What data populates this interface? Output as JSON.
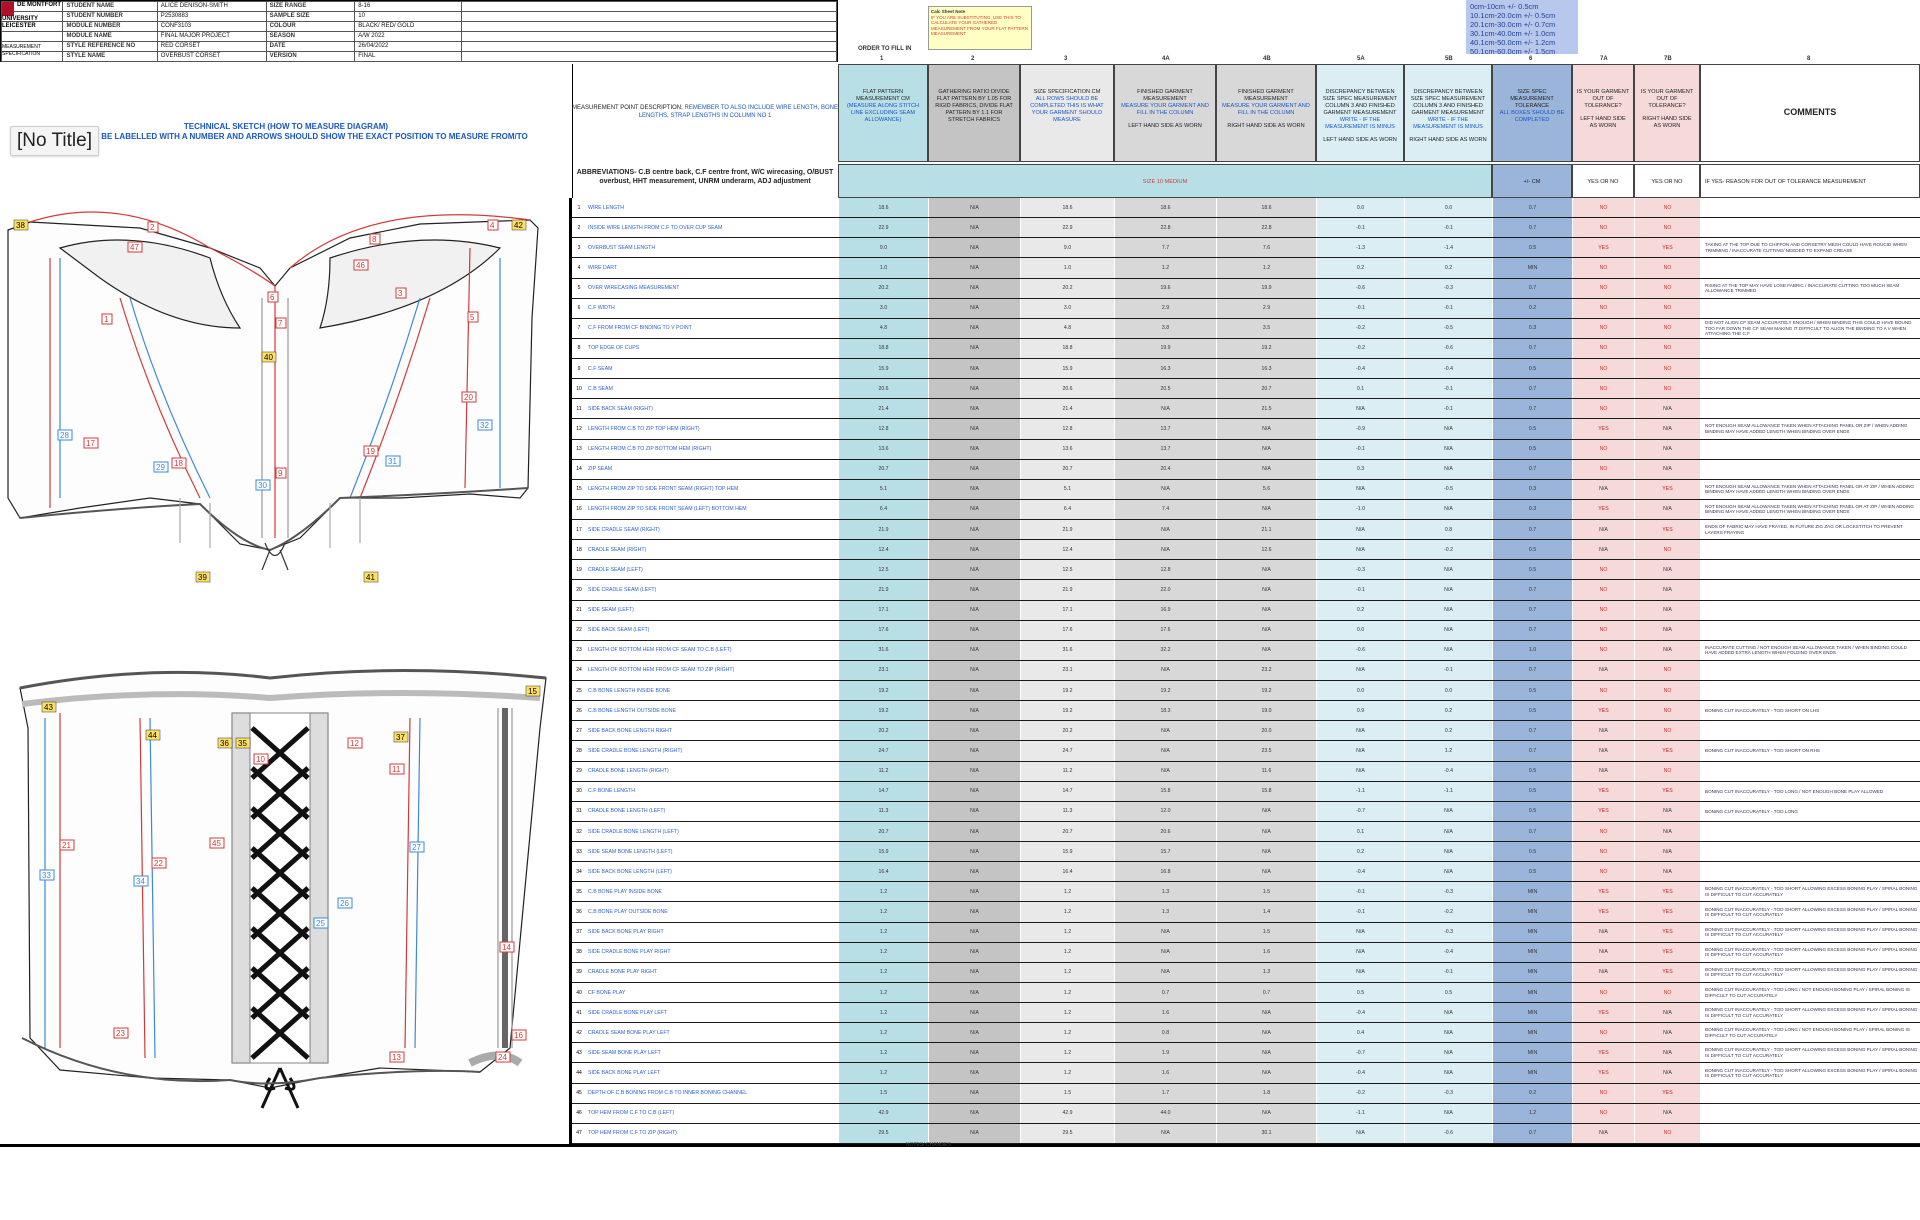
{
  "header": {
    "logo_text": "DE MONTFORT UNIVERSITY LEICESTER",
    "measurement_label": "MEASUREMENT SPECIFICATION",
    "fields": [
      {
        "label": "STUDENT NAME",
        "value": "ALICE DENISON-SMITH",
        "label2": "SIZE RANGE",
        "value2": "8-16"
      },
      {
        "label": "STUDENT NUMBER",
        "value": "P2530883",
        "label2": "SAMPLE SIZE",
        "value2": "10"
      },
      {
        "label": "MODULE NUMBER",
        "value": "CONF3103",
        "label2": "COLOUR",
        "value2": "BLACK/ RED/ GOLD"
      },
      {
        "label": "MODULE NAME",
        "value": "FINAL MAJOR PROJECT",
        "label2": "SEASON",
        "value2": "A/W 2022"
      },
      {
        "label": "STYLE REFERENCE NO",
        "value": "RED CORSET",
        "label2": "DATE",
        "value2": "26/04/2022"
      },
      {
        "label": "STYLE NAME",
        "value": "OVERBUST CORSET",
        "label2": "VERSION",
        "value2": "FINAL"
      }
    ]
  },
  "sticky_note": {
    "title": "Calc Sheet Note",
    "text": "IF YOU ARE SUBSTITUTING, USE THIS TO CALCULATE YOUR GATHERED MEASUREMENT FROM YOUR FLAT PATTERN MEASUREMENT"
  },
  "tolerance_box": [
    "0cm-10cm +/- 0.5cm",
    "10.1cm-20.0cm +/- 0.5cm",
    "20.1cm-30.0cm +/- 0.7cm",
    "30.1cm-40.0cm +/- 1.0cm",
    "40.1cm-50.0cm +/- 1.2cm",
    "50.1cm-60.0cm +/- 1.5cm"
  ],
  "order_to_fill_in": "ORDER TO FILL IN",
  "order_numbers": [
    "1",
    "2",
    "3",
    "4A",
    "4B",
    "5A",
    "5B",
    "6",
    "7A",
    "7B",
    "8"
  ],
  "technical_sketch": {
    "title": "TECHNICAL SKETCH (HOW TO MEASURE DIAGRAM)",
    "subtitle": "POINTS MUST BE LABELLED WITH A NUMBER AND ARROWS SHOULD SHOW THE EXACT POSITION TO MEASURE FROM/TO"
  },
  "popup_title": "[No Title]",
  "measurement_desc": {
    "title": "MEASUREMENT POINT DESCRIPTION,",
    "note": "REMEMBER TO ALSO INCLUDE WIRE LENGTH, BONE LENGTHS, STRAP LENGTHS IN COLUMN NO 1"
  },
  "abbreviations": "ABBREVIATIONS- C.B centre back, C.F centre front, W/C wirecasing, O/BUST overbust, HHT measurement, UNRM underarm, ADJ adjustment",
  "columns": [
    {
      "key": "flat",
      "title": "FLAT PATTERN MEASUREMENT CM",
      "note": "(MEASURE ALONG STITCH LINE EXCLUDING SEAM ALLOWANCE)"
    },
    {
      "key": "ratio",
      "title": "GATHERING RATIO DIVIDE FLAT PATTERN BY 1.05 FOR RIGID FABRICS, DIVIDE FLAT PATTERN BY 1.1 FOR STRETCH FABRICS",
      "note": ""
    },
    {
      "key": "spec",
      "title": "SIZE SPECIFICATION CM",
      "note": "ALL ROWS SHOULD BE COMPLETED THIS IS WHAT YOUR GARMENT SHOULD MEASURE"
    },
    {
      "key": "left",
      "title": "FINISHED GARMENT MEASUREMENT",
      "note": "MEASURE YOUR GARMENT AND FILL IN THE COLUMN",
      "foot": "LEFT HAND SIDE AS WORN"
    },
    {
      "key": "right",
      "title": "FINISHED GARMENT MEASUREMENT",
      "note": "MEASURE YOUR GARMENT AND FILL IN THE COLUMN",
      "foot": "RIGHT HAND SIDE AS WORN"
    },
    {
      "key": "disc_l",
      "title": "DISCREPANCY BETWEEN SIZE SPEC MEASUREMENT COLUMN 3 AND FINISHED GARMENT MEASUREMENT",
      "note": "WRITE - IF THE MEASUREMENT IS MINUS",
      "foot": "LEFT HAND SIDE AS WORN"
    },
    {
      "key": "disc_r",
      "title": "DISCREPANCY BETWEEN SIZE SPEC MEASUREMENT COLUMN 3 AND FINISHED GARMENT MEASUREMENT",
      "note": "WRITE - IF THE MEASUREMENT IS MINUS",
      "foot": "RIGHT HAND SIDE AS WORN"
    },
    {
      "key": "tol",
      "title": "SIZE SPEC MEASUREMENT TOLERANCE",
      "note": "ALL BOXES SHOULD BE COMPLETED"
    },
    {
      "key": "ool",
      "title": "IS YOUR GARMENT OUT OF TOLERANCE?",
      "note": "",
      "foot": "LEFT HAND SIDE AS WORN"
    },
    {
      "key": "oor",
      "title": "IS YOUR GARMENT OUT OF TOLERANCE?",
      "note": "",
      "foot": "RIGHT HAND SIDE AS WORN"
    },
    {
      "key": "com",
      "title": "COMMENTS",
      "note": ""
    }
  ],
  "subheaders": {
    "size_label": "SIZE",
    "size_value": "10",
    "size_suffix": "MEDIUM",
    "tol": "+/- CM",
    "yes_no_l": "YES OR NO",
    "yes_no_r": "YES OR NO",
    "comments": "IF YES- REASON FOR OUT OF TOLERANCE MEASUREMENT"
  },
  "rows": [
    {
      "n": "1",
      "d": "WIRE LENGTH",
      "f": "18.6",
      "r": "N/A",
      "s": "18.6",
      "l": "18.6",
      "rr": "18.6",
      "dl": "0.0",
      "dr": "0.0",
      "t": "0.7",
      "ol": "NO",
      "or": "NO",
      "c": ""
    },
    {
      "n": "2",
      "d": "INSIDE WIRE LENGTH FROM C.F TO OVER CUP SEAM",
      "f": "22.9",
      "r": "N/A",
      "s": "22.9",
      "l": "22.8",
      "rr": "22.8",
      "dl": "-0.1",
      "dr": "-0.1",
      "t": "0.7",
      "ol": "NO",
      "or": "NO",
      "c": ""
    },
    {
      "n": "3",
      "d": "OVERBUST SEAM LENGTH",
      "f": "9.0",
      "r": "N/A",
      "s": "9.0",
      "l": "7.7",
      "rr": "7.6",
      "dl": "-1.3",
      "dr": "-1.4",
      "t": "0.5",
      "ol": "YES",
      "or": "YES",
      "c": "TAKING AT THE TOP DUE TO CHIFFON AND CORSETRY MESH COULD HAVE ROUCID WHEN TRIMMING / INACCURATE CUTTING/ NEEDED TO EXPAND CREASE"
    },
    {
      "n": "4",
      "d": "WIRE DART",
      "f": "1.0",
      "r": "N/A",
      "s": "1.0",
      "l": "1.2",
      "rr": "1.2",
      "dl": "0.2",
      "dr": "0.2",
      "t": "MIN",
      "ol": "NO",
      "or": "NO",
      "c": ""
    },
    {
      "n": "5",
      "d": "OVER WIRECASING MEASUREMENT",
      "f": "20.2",
      "r": "N/A",
      "s": "20.2",
      "l": "19.6",
      "rr": "19.9",
      "dl": "-0.6",
      "dr": "-0.3",
      "t": "0.7",
      "ol": "NO",
      "or": "NO",
      "c": "RISING AT THE TOP MAY HAVE LOSE FABRIC / INACCURATE CUTTING TOO MUCH SEAM ALLOWANCE TRIMMED"
    },
    {
      "n": "6",
      "d": "C.F WIDTH",
      "f": "3.0",
      "r": "N/A",
      "s": "3.0",
      "l": "2.9",
      "rr": "2.9",
      "dl": "-0.1",
      "dr": "-0.1",
      "t": "0.2",
      "ol": "NO",
      "or": "NO",
      "c": ""
    },
    {
      "n": "7",
      "d": "C.F FROM FROM CF BINDING TO V POINT",
      "f": "4.8",
      "r": "N/A",
      "s": "4.8",
      "l": "3.8",
      "rr": "3.5",
      "dl": "-0.2",
      "dr": "-0.5",
      "t": "0.3",
      "ol": "NO",
      "or": "NO",
      "c": "DID NOT ALIGN CF SEAM ACCURATELY ENOUGH / WHEN BINDING THIS COULD HAVE BOUND TOO FAR DOWN THE CF SEAM MAKING IT DIFFICULT TO ALIGN THE BINDING TO A V WHEN ATTACHING THE C.F"
    },
    {
      "n": "8",
      "d": "TOP EDGE OF CUPS",
      "f": "18.8",
      "r": "N/A",
      "s": "18.8",
      "l": "19.9",
      "rr": "19.2",
      "dl": "-0.2",
      "dr": "-0.6",
      "t": "0.7",
      "ol": "NO",
      "or": "NO",
      "c": ""
    },
    {
      "n": "9",
      "d": "C.F SEAM",
      "f": "15.9",
      "r": "N/A",
      "s": "15.9",
      "l": "16.3",
      "rr": "16.3",
      "dl": "-0.4",
      "dr": "-0.4",
      "t": "0.5",
      "ol": "NO",
      "or": "NO",
      "c": ""
    },
    {
      "n": "10",
      "d": "C.B SEAM",
      "f": "20.6",
      "r": "N/A",
      "s": "20.6",
      "l": "20.5",
      "rr": "20.7",
      "dl": "0.1",
      "dr": "-0.1",
      "t": "0.7",
      "ol": "NO",
      "or": "NO",
      "c": ""
    },
    {
      "n": "11",
      "d": "SIDE BACK SEAM (RIGHT)",
      "f": "21.4",
      "r": "N/A",
      "s": "21.4",
      "l": "N/A",
      "rr": "21.5",
      "dl": "N/A",
      "dr": "-0.1",
      "t": "0.7",
      "ol": "NO",
      "or": "N/A",
      "c": ""
    },
    {
      "n": "12",
      "d": "LENGTH FROM C.B TO ZIP TOP HEM (RIGHT)",
      "f": "12.8",
      "r": "N/A",
      "s": "12.8",
      "l": "13.7",
      "rr": "N/A",
      "dl": "-0.9",
      "dr": "N/A",
      "t": "0.5",
      "ol": "YES",
      "or": "N/A",
      "c": "NOT ENOUGH SEAM ALLOWANCE TAKEN WHEN ATTACHING PANEL OR ZIP / WHEN ADDING BINDING MAY HAVE ADDED LENGTH WHEN BINDING OVER ENDS"
    },
    {
      "n": "13",
      "d": "LENGTH FROM C.B TO ZIP BOTTOM HEM (RIGHT)",
      "f": "13.6",
      "r": "N/A",
      "s": "13.6",
      "l": "13.7",
      "rr": "N/A",
      "dl": "-0.1",
      "dr": "N/A",
      "t": "0.5",
      "ol": "NO",
      "or": "N/A",
      "c": ""
    },
    {
      "n": "14",
      "d": "ZIP SEAM",
      "f": "20.7",
      "r": "N/A",
      "s": "20.7",
      "l": "20.4",
      "rr": "N/A",
      "dl": "0.3",
      "dr": "N/A",
      "t": "0.7",
      "ol": "NO",
      "or": "N/A",
      "c": ""
    },
    {
      "n": "15",
      "d": "LENGTH FROM ZIP TO SIDE FRONT SEAM (RIGHT) TOP HEM",
      "f": "5.1",
      "r": "N/A",
      "s": "5.1",
      "l": "N/A",
      "rr": "5.6",
      "dl": "N/A",
      "dr": "-0.5",
      "t": "0.3",
      "ol": "N/A",
      "or": "YES",
      "c": "NOT ENOUGH SEAM ALLOWANCE TAKEN WHEN ATTACHING PANEL OR AT ZIP / WHEN ADDING BINDING MAY HAVE ADDED LENGTH WHEN BINDING OVER ENDS"
    },
    {
      "n": "16",
      "d": "LENGTH FROM ZIP TO SIDE FRONT SEAM (LEFT) BOTTOM HEM",
      "f": "6.4",
      "r": "N/A",
      "s": "6.4",
      "l": "7.4",
      "rr": "N/A",
      "dl": "-1.0",
      "dr": "N/A",
      "t": "0.3",
      "ol": "YES",
      "or": "N/A",
      "c": "NOT ENOUGH SEAM ALLOWANCE TAKEN WHEN ATTACHING PANEL OR AT ZIP / WHEN ADDING BINDING MAY HAVE ADDED LENGTH WHEN BINDING OVER ENDS"
    },
    {
      "n": "17",
      "d": "SIDE CRADLE SEAM (RIGHT)",
      "f": "21.9",
      "r": "N/A",
      "s": "21.9",
      "l": "N/A",
      "rr": "21.1",
      "dl": "N/A",
      "dr": "0.8",
      "t": "0.7",
      "ol": "N/A",
      "or": "YES",
      "c": "ENDS OF FABRIC MAY HAVE FRAYED, IN FUTURE ZIG ZAG OR LOCKSTITCH TO PREVENT LAYERS FRAYING"
    },
    {
      "n": "18",
      "d": "CRADLE SEAM (RIGHT)",
      "f": "12.4",
      "r": "N/A",
      "s": "12.4",
      "l": "N/A",
      "rr": "12.6",
      "dl": "N/A",
      "dr": "-0.2",
      "t": "0.5",
      "ol": "N/A",
      "or": "NO",
      "c": ""
    },
    {
      "n": "19",
      "d": "CRADLE SEAM (LEFT)",
      "f": "12.5",
      "r": "N/A",
      "s": "12.5",
      "l": "12.8",
      "rr": "N/A",
      "dl": "-0.3",
      "dr": "N/A",
      "t": "0.5",
      "ol": "NO",
      "or": "N/A",
      "c": ""
    },
    {
      "n": "20",
      "d": "SIDE CRADLE SEAM (LEFT)",
      "f": "21.9",
      "r": "N/A",
      "s": "21.9",
      "l": "22.0",
      "rr": "N/A",
      "dl": "-0.1",
      "dr": "N/A",
      "t": "0.7",
      "ol": "NO",
      "or": "N/A",
      "c": ""
    },
    {
      "n": "21",
      "d": "SIDE SEAM (LEFT)",
      "f": "17.1",
      "r": "N/A",
      "s": "17.1",
      "l": "16.9",
      "rr": "N/A",
      "dl": "0.2",
      "dr": "N/A",
      "t": "0.7",
      "ol": "NO",
      "or": "N/A",
      "c": ""
    },
    {
      "n": "22",
      "d": "SIDE BACK SEAM (LEFT)",
      "f": "17.6",
      "r": "N/A",
      "s": "17.6",
      "l": "17.6",
      "rr": "N/A",
      "dl": "0.0",
      "dr": "N/A",
      "t": "0.7",
      "ol": "NO",
      "or": "N/A",
      "c": ""
    },
    {
      "n": "23",
      "d": "LENGTH OF BOTTOM HEM FROM CF SEAM TO C.B (LEFT)",
      "f": "31.6",
      "r": "N/A",
      "s": "31.6",
      "l": "32.2",
      "rr": "N/A",
      "dl": "-0.6",
      "dr": "N/A",
      "t": "1.0",
      "ol": "NO",
      "or": "N/A",
      "c": "INACCURATE CUTTING / NOT ENOUGH SEAM ALLOWANCE TAKEN / WHEN BINDING COULD HAVE ADDED EXTRA LENGTH WHEN FOLDING OVER ENDS"
    },
    {
      "n": "24",
      "d": "LENGTH OF BOTTOM HEM FROM CF SEAM TO ZIP (RIGHT)",
      "f": "23.1",
      "r": "N/A",
      "s": "23.1",
      "l": "N/A",
      "rr": "23.2",
      "dl": "N/A",
      "dr": "-0.1",
      "t": "0.7",
      "ol": "N/A",
      "or": "NO",
      "c": ""
    },
    {
      "n": "25",
      "d": "C.B BONE LENGTH INSIDE BONE",
      "f": "19.2",
      "r": "N/A",
      "s": "19.2",
      "l": "19.2",
      "rr": "19.2",
      "dl": "0.0",
      "dr": "0.0",
      "t": "0.5",
      "ol": "NO",
      "or": "NO",
      "c": ""
    },
    {
      "n": "26",
      "d": "C.B BONE LENGTH OUTSIDE BONE",
      "f": "19.2",
      "r": "N/A",
      "s": "19.2",
      "l": "18.3",
      "rr": "19.0",
      "dl": "0.9",
      "dr": "0.2",
      "t": "0.5",
      "ol": "YES",
      "or": "NO",
      "c": "BONING CUT INACCURATELY - TOO SHORT ON LHS"
    },
    {
      "n": "27",
      "d": "SIDE BACK BONE LENGTH RIGHT",
      "f": "20.2",
      "r": "N/A",
      "s": "20.2",
      "l": "N/A",
      "rr": "20.0",
      "dl": "N/A",
      "dr": "0.2",
      "t": "0.7",
      "ol": "N/A",
      "or": "NO",
      "c": ""
    },
    {
      "n": "28",
      "d": "SIDE CRADLE BONE LENGTH (RIGHT)",
      "f": "24.7",
      "r": "N/A",
      "s": "24.7",
      "l": "N/A",
      "rr": "23.5",
      "dl": "N/A",
      "dr": "1.2",
      "t": "0.7",
      "ol": "N/A",
      "or": "YES",
      "c": "BONING CUT INACCURATELY - TOO SHORT ON RHS"
    },
    {
      "n": "29",
      "d": "CRADLE BONE LENGTH (RIGHT)",
      "f": "11.2",
      "r": "N/A",
      "s": "11.2",
      "l": "N/A",
      "rr": "11.6",
      "dl": "N/A",
      "dr": "-0.4",
      "t": "0.5",
      "ol": "N/A",
      "or": "NO",
      "c": ""
    },
    {
      "n": "30",
      "d": "C.F BONE LENGTH",
      "f": "14.7",
      "r": "N/A",
      "s": "14.7",
      "l": "15.8",
      "rr": "15.8",
      "dl": "-1.1",
      "dr": "-1.1",
      "t": "0.5",
      "ol": "YES",
      "or": "YES",
      "c": "BONING CUT INACCURATELY - TOO LONG / NOT ENOUGH BONE PLAY ALLOWED"
    },
    {
      "n": "31",
      "d": "CRADLE BONE LENGTH (LEFT)",
      "f": "11.3",
      "r": "N/A",
      "s": "11.3",
      "l": "12.0",
      "rr": "N/A",
      "dl": "-0.7",
      "dr": "N/A",
      "t": "0.5",
      "ol": "YES",
      "or": "N/A",
      "c": "BONING CUT INACCURATELY - TOO LONG"
    },
    {
      "n": "32",
      "d": "SIDE CRADLE BONE LENGTH (LEFT)",
      "f": "20.7",
      "r": "N/A",
      "s": "20.7",
      "l": "20.6",
      "rr": "N/A",
      "dl": "0.1",
      "dr": "N/A",
      "t": "0.7",
      "ol": "NO",
      "or": "N/A",
      "c": ""
    },
    {
      "n": "33",
      "d": "SIDE SEAM BONE LENGTH (LEFT)",
      "f": "15.9",
      "r": "N/A",
      "s": "15.9",
      "l": "15.7",
      "rr": "N/A",
      "dl": "0.2",
      "dr": "N/A",
      "t": "0.5",
      "ol": "NO",
      "or": "N/A",
      "c": ""
    },
    {
      "n": "34",
      "d": "SIDE BACK BONE LENGTH (LEFT)",
      "f": "16.4",
      "r": "N/A",
      "s": "16.4",
      "l": "16.8",
      "rr": "N/A",
      "dl": "-0.4",
      "dr": "N/A",
      "t": "0.5",
      "ol": "NO",
      "or": "N/A",
      "c": ""
    },
    {
      "n": "35",
      "d": "C.B BONE PLAY INSIDE BONE",
      "f": "1.2",
      "r": "N/A",
      "s": "1.2",
      "l": "1.3",
      "rr": "1.5",
      "dl": "-0.1",
      "dr": "-0.3",
      "t": "MIN",
      "ol": "YES",
      "or": "YES",
      "c": "BONING CUT INACCURATELY - TOO SHORT ALLOWING EXCESS BONING PLAY / SPIRAL BONING IS DIFFICULT TO CUT ACCURATELY"
    },
    {
      "n": "36",
      "d": "C.B BONE PLAY OUTSIDE BONE",
      "f": "1.2",
      "r": "N/A",
      "s": "1.2",
      "l": "1.3",
      "rr": "1.4",
      "dl": "-0.1",
      "dr": "-0.2",
      "t": "MIN",
      "ol": "YES",
      "or": "YES",
      "c": "BONING CUT INACCURATELY - TOO SHORT ALLOWING EXCESS BONING PLAY / SPIRAL BONING IS DIFFICULT TO CUT ACCURATELY"
    },
    {
      "n": "37",
      "d": "SIDE BACK BONE PLAY RIGHT",
      "f": "1.2",
      "r": "N/A",
      "s": "1.2",
      "l": "N/A",
      "rr": "1.5",
      "dl": "N/A",
      "dr": "-0.3",
      "t": "MIN",
      "ol": "N/A",
      "or": "YES",
      "c": "BONING CUT INACCURATELY - TOO SHORT ALLOWING EXCESS BONING PLAY / SPIRAL BONING IS DIFFICULT TO CUT ACCURATELY"
    },
    {
      "n": "38",
      "d": "SIDE CRADLE BONE PLAY RIGHT",
      "f": "1.2",
      "r": "N/A",
      "s": "1.2",
      "l": "N/A",
      "rr": "1.6",
      "dl": "N/A",
      "dr": "-0.4",
      "t": "MIN",
      "ol": "N/A",
      "or": "YES",
      "c": "BONING CUT INACCURATELY - TOO SHORT ALLOWING EXCESS BONING PLAY / SPIRAL BONING IS DIFFICULT TO CUT ACCURATELY"
    },
    {
      "n": "39",
      "d": "CRADLE BONE PLAY RIGHT",
      "f": "1.2",
      "r": "N/A",
      "s": "1.2",
      "l": "N/A",
      "rr": "1.3",
      "dl": "N/A",
      "dr": "-0.1",
      "t": "MIN",
      "ol": "N/A",
      "or": "YES",
      "c": "BONING CUT INACCURATELY - TOO SHORT ALLOWING EXCESS BONING PLAY / SPIRAL BONING IS DIFFICULT TO CUT ACCURATELY"
    },
    {
      "n": "40",
      "d": "CF BONE PLAY",
      "f": "1.2",
      "r": "N/A",
      "s": "1.2",
      "l": "0.7",
      "rr": "0.7",
      "dl": "0.5",
      "dr": "0.5",
      "t": "MIN",
      "ol": "NO",
      "or": "NO",
      "c": "BONING CUT INACCURATELY - TOO LONG / NOT ENOUGH BONING PLAY / SPIRAL BONING IS DIFFICULT TO CUT ACCURATELY"
    },
    {
      "n": "41",
      "d": "SIDE CRADLE BONE PLAY LEFT",
      "f": "1.2",
      "r": "N/A",
      "s": "1.2",
      "l": "1.6",
      "rr": "N/A",
      "dl": "-0.4",
      "dr": "N/A",
      "t": "MIN",
      "ol": "YES",
      "or": "N/A",
      "c": "BONING CUT INACCURATELY - TOO SHORT ALLOWING EXCESS BONING PLAY / SPIRAL BONING IS DIFFICULT TO CUT ACCURATELY"
    },
    {
      "n": "42",
      "d": "CRADLE SEAM BONE PLAY LEFT",
      "f": "1.2",
      "r": "N/A",
      "s": "1.2",
      "l": "0.8",
      "rr": "N/A",
      "dl": "0.4",
      "dr": "N/A",
      "t": "MIN",
      "ol": "NO",
      "or": "N/A",
      "c": "BONING CUT INACCURATELY - TOO LONG / NOT ENOUGH BONING PLAY / SPIRAL BONING IS DIFFICULT TO CUT ACCURATELY"
    },
    {
      "n": "43",
      "d": "SIDE SEAM BONE PLAY LEFT",
      "f": "1.2",
      "r": "N/A",
      "s": "1.2",
      "l": "1.9",
      "rr": "N/A",
      "dl": "-0.7",
      "dr": "N/A",
      "t": "MIN",
      "ol": "YES",
      "or": "N/A",
      "c": "BONING CUT INACCURATELY - TOO SHORT ALLOWING EXCESS BONING PLAY / SPIRAL BONING IS DIFFICULT TO CUT ACCURATELY"
    },
    {
      "n": "44",
      "d": "SIDE BACK BONE PLAY LEFT",
      "f": "1.2",
      "r": "N/A",
      "s": "1.2",
      "l": "1.6",
      "rr": "N/A",
      "dl": "-0.4",
      "dr": "N/A",
      "t": "MIN",
      "ol": "YES",
      "or": "N/A",
      "c": "BONING CUT INACCURATELY - TOO SHORT ALLOWING EXCESS BONING PLAY / SPIRAL BONING IS DIFFICULT TO CUT ACCURATELY"
    },
    {
      "n": "45",
      "d": "DEPTH OF C.B BONING FROM C.B TO INNER BONING CHANNEL",
      "f": "1.5",
      "r": "N/A",
      "s": "1.5",
      "l": "1.7",
      "rr": "1.8",
      "dl": "-0.2",
      "dr": "-0.3",
      "t": "0.2",
      "ol": "NO",
      "or": "YES",
      "c": ""
    },
    {
      "n": "46",
      "d": "TOP HEM FROM C.F TO C.B (LEFT)",
      "f": "42.9",
      "r": "N/A",
      "s": "42.9",
      "l": "44.0",
      "rr": "N/A",
      "dl": "-1.1",
      "dr": "N/A",
      "t": "1.2",
      "ol": "NO",
      "or": "N/A",
      "c": ""
    },
    {
      "n": "47",
      "d": "TOP HEM FROM C.F TO ZIP (RIGHT)",
      "f": "29.5",
      "r": "N/A",
      "s": "29.5",
      "l": "N/A",
      "rr": "30.1",
      "dl": "N/A",
      "dr": "-0.6",
      "t": "0.7",
      "ol": "N/A",
      "or": "NO",
      "c": ""
    }
  ],
  "footnote": "NOTES/ CHANGES",
  "colors": {
    "flat": "#b9dfe6",
    "ratio": "#c4c4c4",
    "spec": "#e9e9e9",
    "left": "#d8d8d8",
    "right": "#d8d8d8",
    "disc": "#daeef4",
    "tol": "#9bb4d9",
    "oot": "#f6dada",
    "com": "#ffffff",
    "red": "#d23a3a",
    "blue": "#1a56c4"
  }
}
